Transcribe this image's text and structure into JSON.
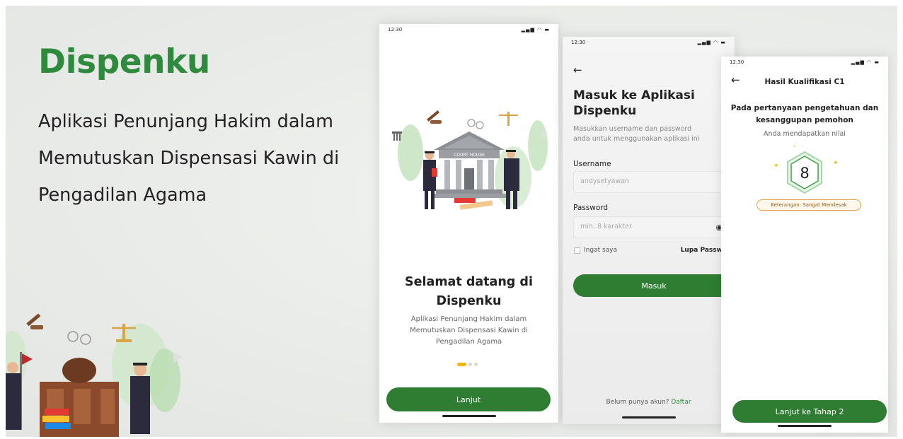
{
  "hero": {
    "brand": "Dispenku",
    "tagline": "Aplikasi Penunjang Hakim dalam\nMemutuskan Dispensasi Kawin di\nPengadilan Agama"
  },
  "screen1": {
    "time": "12:30",
    "title": "Selamat datang di\nDispenku",
    "description": "Aplikasi Penunjang Hakim dalam\nMemutuskan Dispensasi Kawin di\nPengadilan Agama",
    "court_label": "COURT HOUSE",
    "button": "Lanjut",
    "page_index": 0,
    "page_count": 3
  },
  "screen2": {
    "time": "12:30",
    "title": "Masuk ke Aplikasi\nDispenku",
    "subtitle": "Masukkan username dan password\nanda untuk menggunakan aplikasi ini",
    "username_label": "Username",
    "username_value": "andysetyawan",
    "password_label": "Password",
    "password_placeholder": "min. 8 karakter",
    "remember_label": "Ingat saya",
    "forgot_label": "Lupa Password",
    "button": "Masuk",
    "signup_prompt": "Belum punya akun?",
    "signup_link": "Daftar"
  },
  "screen3": {
    "time": "12:30",
    "header": "Hasil Kualifikasi C1",
    "question": "Pada pertanyaan pengetahuan dan\nkesanggupan pemohon",
    "subtitle": "Anda mendapatkan nilai",
    "score": "8",
    "badge": "Keterangan: Sangat Mendesak",
    "button": "Lanjut ke Tahap 2"
  },
  "icons": {
    "status": "signal-wifi-battery-icons",
    "back": "back-arrow-icon",
    "eye": "eye-icon"
  },
  "colors": {
    "brand_green": "#2e8b3e",
    "button_green": "#2e7d32",
    "accent_yellow": "#f2b705"
  }
}
